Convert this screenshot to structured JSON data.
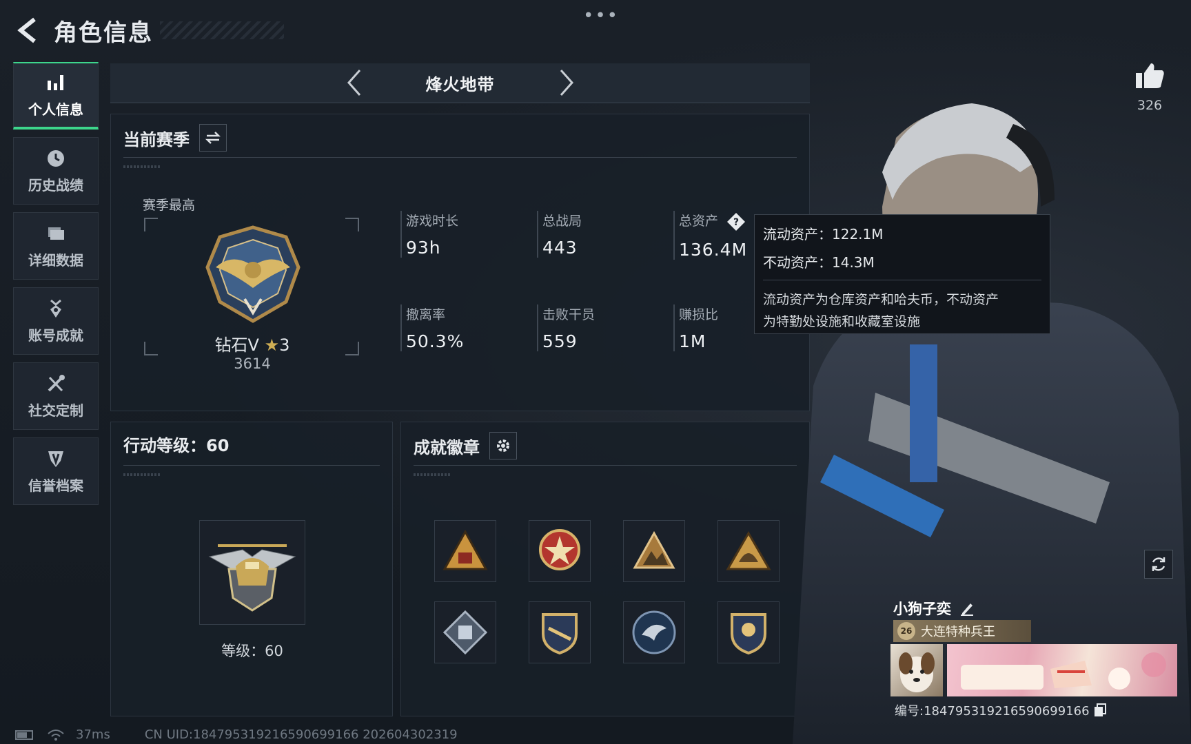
{
  "header": {
    "title": "角色信息"
  },
  "sidebar": {
    "items": [
      {
        "label": "个人信息",
        "icon": "bar-chart-icon",
        "active": true
      },
      {
        "label": "历史战绩",
        "icon": "clock-icon",
        "active": false
      },
      {
        "label": "详细数据",
        "icon": "folder-icon",
        "active": false
      },
      {
        "label": "账号成就",
        "icon": "medal-icon",
        "active": false
      },
      {
        "label": "社交定制",
        "icon": "tools-icon",
        "active": false
      },
      {
        "label": "信誉档案",
        "icon": "shield-icon",
        "active": false
      }
    ]
  },
  "mode": {
    "title": "烽火地带"
  },
  "season": {
    "title": "当前赛季",
    "best_label": "赛季最高",
    "rank_name": "钻石V",
    "rank_stars": "3",
    "rank_score": "3614",
    "stats": [
      {
        "label": "游戏时长",
        "value": "93h"
      },
      {
        "label": "总战局",
        "value": "443"
      },
      {
        "label": "总资产",
        "value": "136.4M"
      },
      {
        "label": "撤离率",
        "value": "50.3%"
      },
      {
        "label": "击败干员",
        "value": "559"
      },
      {
        "label": "赚损比",
        "value": "1M"
      }
    ]
  },
  "tooltip": {
    "liquid": "流动资产：122.1M",
    "fixed": "不动资产：14.3M",
    "desc_line1": "流动资产为仓库资产和哈夫币，不动资产",
    "desc_line2": "为特勤处设施和收藏室设施"
  },
  "level": {
    "title": "行动等级：60",
    "text": "等级：60"
  },
  "badges": {
    "title": "成就徽章"
  },
  "profile": {
    "likes": "326",
    "name": "小狗子奕",
    "tag_level": "26",
    "tag": "大连特种兵王",
    "id": "编号:184795319216590699166"
  },
  "status": {
    "ping": "37ms",
    "uid": "CN UID:184795319216590699166 202604302319"
  },
  "colors": {
    "accent": "#3dd68c",
    "gold": "#cfae54",
    "panel": "#181f28"
  }
}
